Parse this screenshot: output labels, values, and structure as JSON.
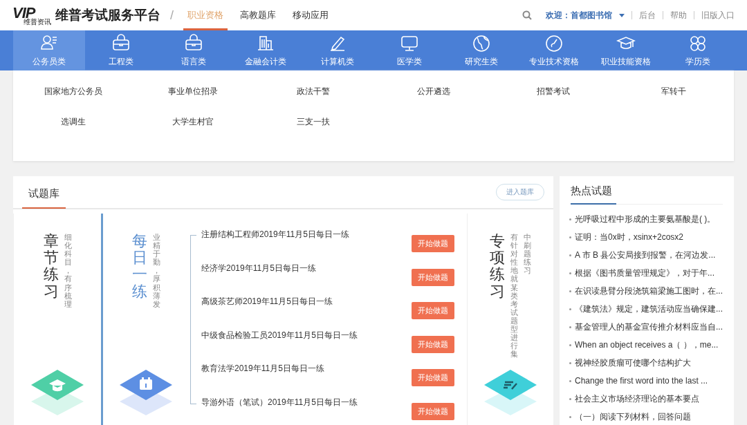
{
  "header": {
    "logo": {
      "mark": "VIP",
      "sub": "维普资讯"
    },
    "title": "维普考试服务平台",
    "separator": "/",
    "nav": [
      {
        "label": "职业资格",
        "selected": true
      },
      {
        "label": "高教题库",
        "selected": false
      },
      {
        "label": "移动应用",
        "selected": false
      }
    ],
    "welcome": "欢迎：首都图书馆",
    "links": [
      "后台",
      "帮助",
      "旧版入口"
    ]
  },
  "categories": [
    {
      "label": "公务员类",
      "selected": true
    },
    {
      "label": "工程类",
      "selected": false
    },
    {
      "label": "语言类",
      "selected": false
    },
    {
      "label": "金融会计类",
      "selected": false
    },
    {
      "label": "计算机类",
      "selected": false
    },
    {
      "label": "医学类",
      "selected": false
    },
    {
      "label": "研究生类",
      "selected": false
    },
    {
      "label": "专业技术资格",
      "selected": false
    },
    {
      "label": "职业技能资格",
      "selected": false
    },
    {
      "label": "学历类",
      "selected": false
    }
  ],
  "subcategories": [
    "国家地方公务员",
    "事业单位招录",
    "政法干警",
    "公开遴选",
    "招警考试",
    "军转干",
    "选调生",
    "大学生村官",
    "三支一扶"
  ],
  "question_bank": {
    "title": "试题库",
    "enter_button": "进入题库",
    "chapter": {
      "title": "章节练习",
      "subtitle": "细化科目，有序梳理"
    },
    "daily": {
      "title": "每日一练",
      "subtitle": "业精于勤，厚积薄发",
      "items": [
        {
          "name": "注册结构工程师2019年11月5日每日一练",
          "button": "开始做题"
        },
        {
          "name": "经济学2019年11月5日每日一练",
          "button": "开始做题"
        },
        {
          "name": "高级茶艺师2019年11月5日每日一练",
          "button": "开始做题"
        },
        {
          "name": "中级食品检验工员2019年11月5日每日一练",
          "button": "开始做题"
        },
        {
          "name": "教育法学2019年11月5日每日一练",
          "button": "开始做题"
        },
        {
          "name": "导游外语（笔试）2019年11月5日每日一练",
          "button": "开始做题"
        }
      ]
    },
    "special": {
      "title": "专项练习",
      "subtitle_columns": [
        "有针对性地就某类考试题型进行集",
        "中刷题练习"
      ]
    }
  },
  "hot": {
    "title": "热点试题",
    "items": [
      "光呼吸过程中形成的主要氨基酸是( )。",
      "证明：当0x时，xsinx+2cosx2",
      "A 市 B 县公安局接到报警，在河边发...",
      "根据《图书质量管理规定》，对于年...",
      "在识读悬臂分段浇筑箱梁施工图时，在...",
      "《建筑法》规定，建筑活动应当确保建...",
      "基金管理人的基金宣传推介材料应当自...",
      "When an object receives a（ ），me...",
      "视神经胶质瘤可使哪个结构扩大",
      "Change the first word into the last ...",
      "社会主义市场经济理论的基本要点",
      "（一）阅读下列材料，回答问题"
    ]
  }
}
